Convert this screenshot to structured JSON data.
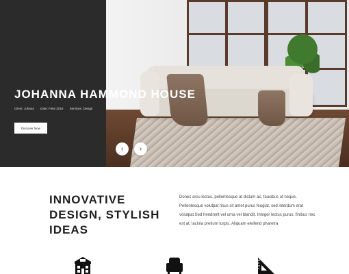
{
  "hero": {
    "title": "JOHANNA HAMMOND HOUSE",
    "client": "Client: Johana",
    "date": "Date: Febs 2019",
    "services": "Services: Design",
    "cta_label": "Discover Now",
    "prev_glyph": "‹",
    "next_glyph": "›"
  },
  "intro": {
    "heading_line1": "INNOVATIVE",
    "heading_line2": "DESIGN, STYLISH",
    "heading_line3": "IDEAS",
    "paragraph": "Donec arcu lectus, pellentesque at dictum ac, faucibus ut neque. Pellentesque volutpat risus sit amet purus feugiat, sed interdum erat volutpat.Sed hendrerit vel urna vel blandit. Integer lectus purus, finibus nec est at, lacinia pretium turpis. Aliquam eleifend pharetra"
  },
  "features": [
    {
      "icon": "building-icon"
    },
    {
      "icon": "armchair-icon"
    },
    {
      "icon": "set-square-icon"
    }
  ],
  "colors": {
    "hero_dark": "#2b2b2b",
    "text_dark": "#1e1e1e",
    "white": "#ffffff"
  }
}
